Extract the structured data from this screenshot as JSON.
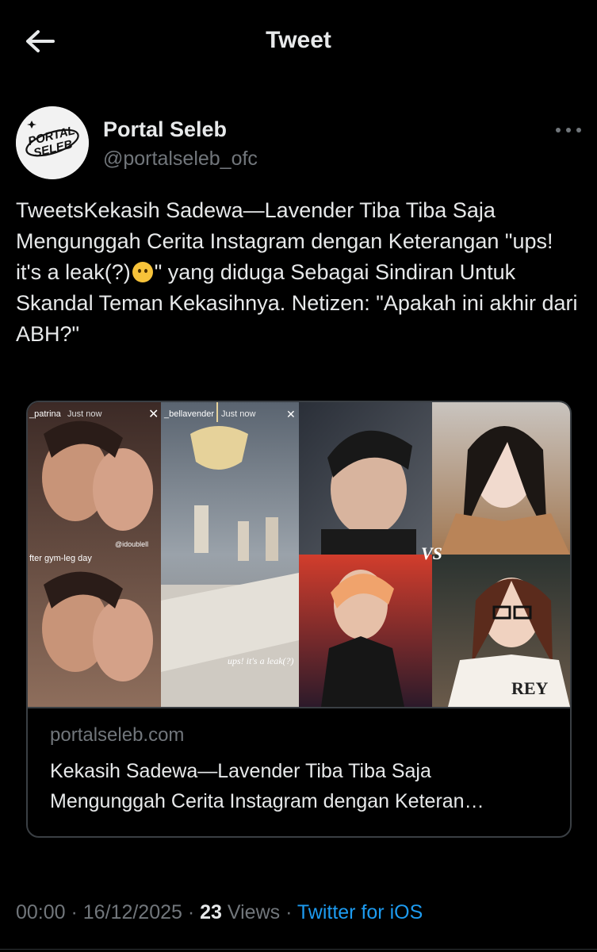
{
  "header": {
    "title": "Tweet",
    "back_icon": "arrow-left-icon"
  },
  "author": {
    "name": "Portal Seleb",
    "handle": "@portalseleb_ofc",
    "avatar_text": "PORTAL SELEB",
    "more_icon": "more-horizontal-icon"
  },
  "tweet": {
    "text_part1": "TweetsKekasih Sadewa—Lavender Tiba Tiba Saja Mengunggah Cerita Instagram dengan Keterangan \"ups! it's a leak(?)",
    "emoji": "face-with-open-eyes-and-hand-over-mouth",
    "text_part2": "\" yang diduga Sebagai Sindiran Untuk Skandal Teman Kekasihnya. Netizen: \"Apakah ini akhir dari ABH?\""
  },
  "card": {
    "domain": "portalseleb.com",
    "title_line1": "Kekasih Sadewa—Lavender Tiba Tiba Saja",
    "title_line2": "Mengunggah Cerita Instagram dengan Keteran…",
    "image": {
      "story1_user": "_patrina",
      "story1_time": "Just now",
      "story1_caption": "fter gym-leg day",
      "story1_tag": "@idoublell",
      "story2_user": "_bellavender",
      "story2_time": "Just now",
      "story2_caption": "ups! it's a leak(?)",
      "vs_label": "VS",
      "shirt_text": "REY"
    }
  },
  "meta": {
    "time": "00:00",
    "separator": " · ",
    "date": "16/12/2025",
    "views_count": "23",
    "views_label": " Views",
    "source": "Twitter for iOS"
  },
  "colors": {
    "background": "#000000",
    "text": "#e7e9ea",
    "muted": "#71767b",
    "link": "#1d9bf0",
    "border": "#3a3f44"
  }
}
